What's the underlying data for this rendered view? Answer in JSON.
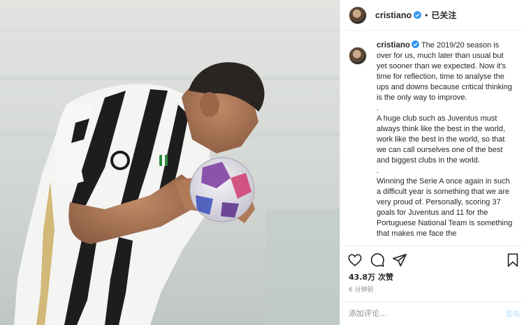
{
  "header": {
    "username": "cristiano",
    "separator": "•",
    "follow_state": "已关注"
  },
  "caption": {
    "username": "cristiano",
    "paragraphs": [
      "The 2019/20 season is over for us, much later than usual but yet sooner than we expected. Now it's time for reflection, time to analyse the ups and downs because critical thinking is the only way to improve.",
      ".",
      "A huge club such as Juventus must always think like the best in the world, work like the best in the world, so that we can call ourselves one of the best and biggest clubs in the world.",
      ".",
      "Winning the Serie A once again in such a difficult year is something that we are very proud of. Personally, scoring 37 goals for Juventus and 11 for the Portuguese National Team is something that makes me face the"
    ]
  },
  "actions": {
    "like_icon": "heart-icon",
    "comment_icon": "comment-icon",
    "share_icon": "paper-plane-icon",
    "save_icon": "bookmark-icon"
  },
  "stats": {
    "likes": "43.8万 次赞",
    "time": "6 分钟前"
  },
  "comment_box": {
    "placeholder": "添加评论...",
    "post_label": "发布"
  },
  "colors": {
    "verified_blue": "#3897f0",
    "post_button": "#b2dffc",
    "muted_text": "#8e8e8e"
  }
}
